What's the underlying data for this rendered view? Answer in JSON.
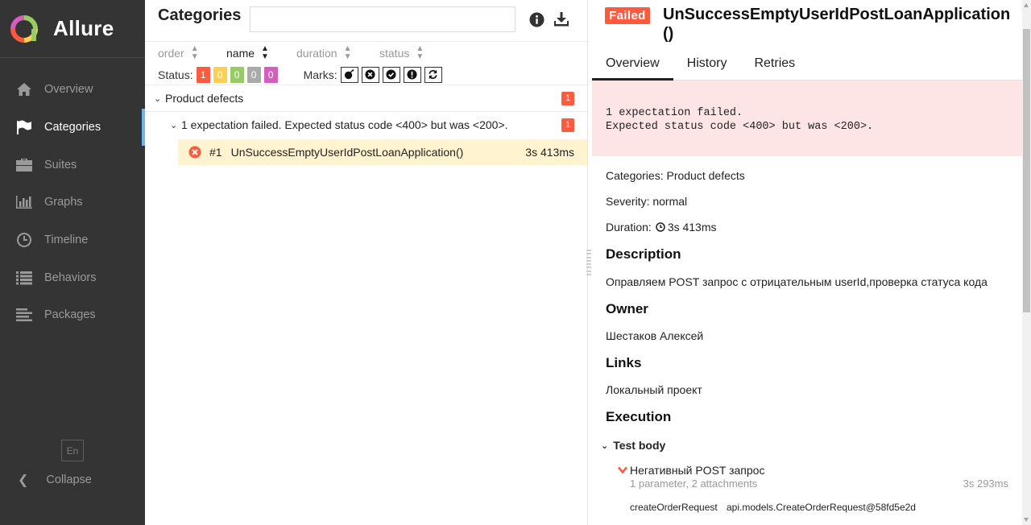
{
  "app": {
    "name": "Allure"
  },
  "sidebar": {
    "items": [
      {
        "label": "Overview",
        "icon": "home-icon"
      },
      {
        "label": "Categories",
        "icon": "flag-icon"
      },
      {
        "label": "Suites",
        "icon": "briefcase-icon"
      },
      {
        "label": "Graphs",
        "icon": "bar-chart-icon"
      },
      {
        "label": "Timeline",
        "icon": "clock-icon"
      },
      {
        "label": "Behaviors",
        "icon": "list-icon"
      },
      {
        "label": "Packages",
        "icon": "align-left-icon"
      }
    ],
    "active": "Categories",
    "lang": "En",
    "collapse_label": "Collapse"
  },
  "categories_pane": {
    "title": "Categories",
    "search": {
      "value": "",
      "placeholder": ""
    },
    "sort": {
      "columns": [
        "order",
        "name",
        "duration",
        "status"
      ],
      "active": "name"
    },
    "filter": {
      "status_label": "Status:",
      "status_counts": [
        {
          "value": "1",
          "color": "#fd5a3e"
        },
        {
          "value": "0",
          "color": "#ffd050"
        },
        {
          "value": "0",
          "color": "#97cc64"
        },
        {
          "value": "0",
          "color": "#aaaaaa"
        },
        {
          "value": "0",
          "color": "#d35ebe"
        }
      ],
      "marks_label": "Marks:"
    },
    "tree": {
      "category": {
        "label": "Product defects",
        "count": "1"
      },
      "group": {
        "label": "1 expectation failed. Expected status code <400> but was <200>.",
        "count": "1"
      },
      "test": {
        "index": "#1",
        "name": "UnSuccessEmptyUserIdPostLoanApplication()",
        "duration": "3s 413ms"
      }
    }
  },
  "details": {
    "status": "Failed",
    "title": "UnSuccessEmptyUserIdPostLoanApplication()",
    "tabs": [
      "Overview",
      "History",
      "Retries"
    ],
    "active_tab": "Overview",
    "error_message": "1 expectation failed.\nExpected status code <400> but was <200>.",
    "categories_line": "Categories: Product defects",
    "severity_line": "Severity: normal",
    "duration_label": "Duration:",
    "duration_value": "3s 413ms",
    "description_heading": "Description",
    "description": "Оправляем POST запрос с отрицательным userId,проверка статуса кода",
    "owner_heading": "Owner",
    "owner": "Шестаков Алексей",
    "links_heading": "Links",
    "link": "Локальный проект",
    "execution_heading": "Execution",
    "test_body_label": "Test body",
    "step": {
      "name": "Негативный POST запрос",
      "meta": "1 parameter, 2 attachments",
      "duration": "3s 293ms",
      "param_name": "createOrderRequest",
      "param_value": "api.models.CreateOrderRequest@58fd5e2d"
    }
  },
  "colors": {
    "sidebar_bg": "#343434",
    "failed": "#fd5a3e",
    "selected_row": "#fff4cf",
    "error_bg": "#fde5e5",
    "active_indicator": "#6fb4f0"
  }
}
